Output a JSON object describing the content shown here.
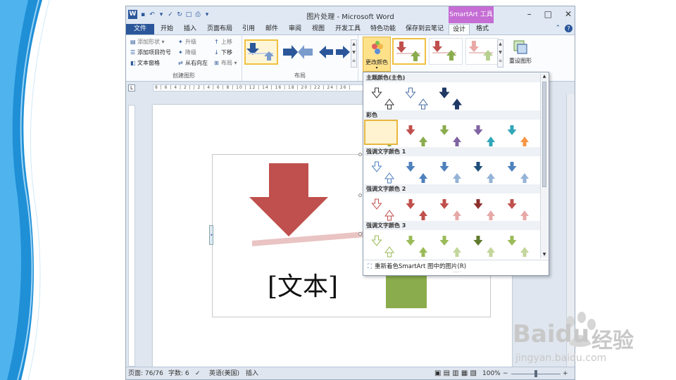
{
  "titlebar": {
    "title": "图片处理 - Microsoft Word",
    "context_tab": "SmartArt 工具",
    "word_logo": "W"
  },
  "tabs": [
    {
      "label": "文件"
    },
    {
      "label": "开始"
    },
    {
      "label": "插入"
    },
    {
      "label": "页面布局"
    },
    {
      "label": "引用"
    },
    {
      "label": "邮件"
    },
    {
      "label": "审阅"
    },
    {
      "label": "视图"
    },
    {
      "label": "开发工具"
    },
    {
      "label": "特色功能"
    },
    {
      "label": "保存到云笔记"
    },
    {
      "label": "设计"
    },
    {
      "label": "格式"
    }
  ],
  "ribbon": {
    "create_graphic": {
      "label": "创建图形",
      "add_shape": "添加形状",
      "add_bullet": "添加项目符号",
      "text_pane": "文本窗格",
      "promote": "升级",
      "demote": "降级",
      "right_to_left": "从右向左",
      "move_up": "上移",
      "move_down": "下移",
      "layout_menu": "布局"
    },
    "layouts": {
      "label": "布局"
    },
    "change_colors": "更改颜色",
    "reset_graphic": "重设图形"
  },
  "ruler": {
    "text": "8 | 6 | 4 | 2 | | 2 | 4 | 6 | 8 | 10 | 12 | 14 | 16 | 18 | 20 | 22 | 24 | 26 |"
  },
  "document": {
    "placeholder": "[文本]"
  },
  "dropdown": {
    "sections": [
      {
        "title": "主题颜色(主色)"
      },
      {
        "title": "彩色"
      },
      {
        "title": "强调文字颜色 1"
      },
      {
        "title": "强调文字颜色 2"
      },
      {
        "title": "强调文字颜色 3"
      }
    ],
    "footer": "重新着色SmartArt 图中的图片(R)"
  },
  "status": {
    "page": "页面: 76/76",
    "words": "字数: 6",
    "language": "英语(美国)",
    "insert_mode": "插入",
    "zoom": "100%"
  },
  "colors": {
    "word_blue": "#2b579a",
    "smartart_tab": "#c56dd4",
    "red_arrow": "#c0504d",
    "green_box": "#8aac4c",
    "selection": "#f0c040"
  },
  "watermark": {
    "brand": "Baidu",
    "cn": "经验",
    "url": "jingyan.baidu.com"
  }
}
